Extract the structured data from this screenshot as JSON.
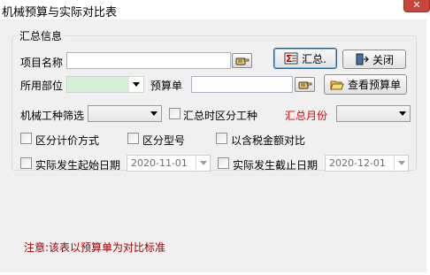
{
  "window": {
    "title": "机械预算与实际对比表",
    "close_glyph": "✕"
  },
  "group": {
    "title": "汇总信息"
  },
  "labels": {
    "project_name": "项目名称",
    "department": "所用部位",
    "budget_doc": "预算单",
    "machine_type_filter": "机械工种筛选",
    "summary_month": "汇总月份",
    "note": "注意:该表以预算单为对比标准"
  },
  "buttons": {
    "summary": "汇总.",
    "close": "关闭",
    "view_budget": "查看预算单"
  },
  "inputs": {
    "project_name_value": "",
    "department_value": "",
    "budget_doc_value": "",
    "machine_type_value": "",
    "summary_month_value": ""
  },
  "checkboxes": {
    "distinguish_work_type": {
      "label": "汇总时区分工种",
      "checked": false
    },
    "distinguish_pricing": {
      "label": "区分计价方式",
      "checked": false
    },
    "distinguish_model": {
      "label": "区分型号",
      "checked": false
    },
    "tax_included": {
      "label": "以含税金额对比",
      "checked": false
    },
    "actual_start": {
      "label": "实际发生起始日期",
      "checked": false
    },
    "actual_end": {
      "label": "实际发生截止日期",
      "checked": false
    }
  },
  "dates": {
    "start": "2020-11-01",
    "end": "2020-12-01"
  },
  "icons": {
    "lookup": "hand-pointer-icon",
    "summary": "sum-table-icon",
    "close": "exit-door-icon",
    "view_budget": "open-folder-icon"
  }
}
